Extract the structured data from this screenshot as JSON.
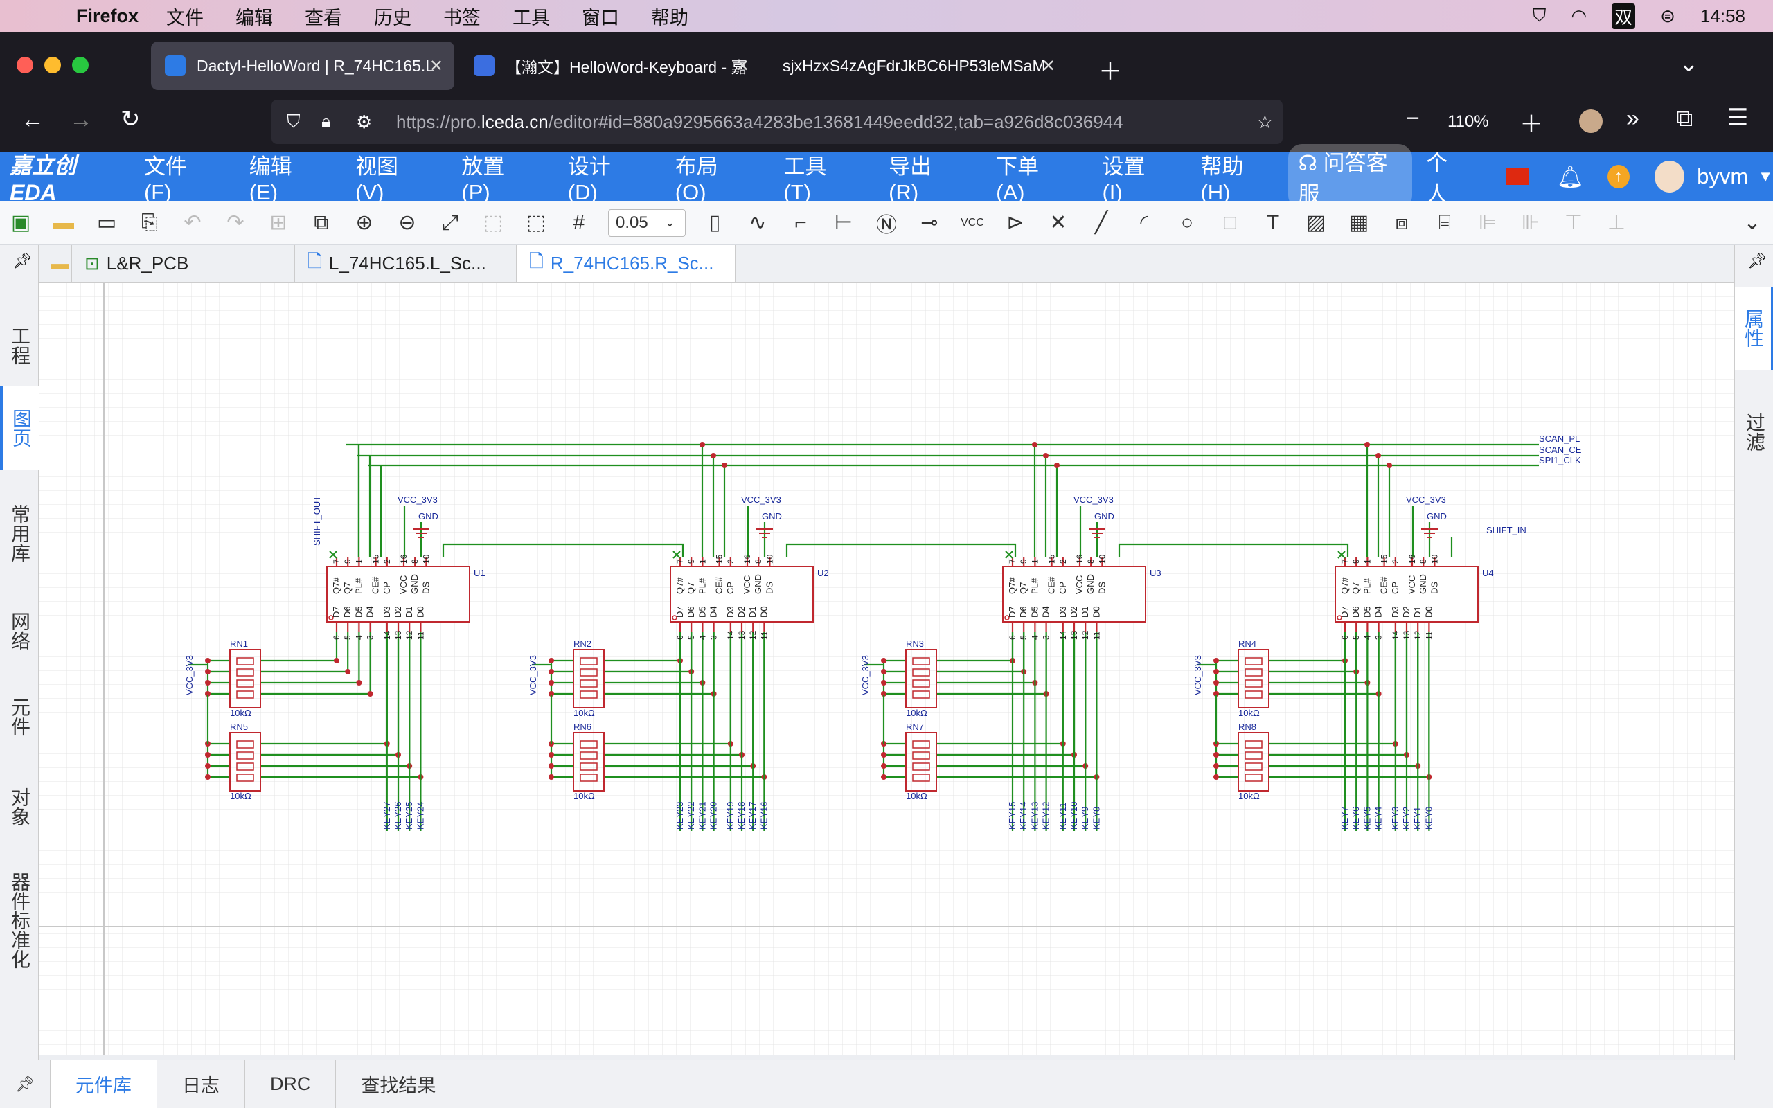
{
  "os_menubar": {
    "app": "Firefox",
    "items": [
      "文件",
      "编辑",
      "查看",
      "历史",
      "书签",
      "工具",
      "窗口",
      "帮助"
    ],
    "ime": "双",
    "clock": "14:58"
  },
  "browser": {
    "tabs": [
      {
        "title": "Dactyl-HelloWord | R_74HC165.L",
        "active": true
      },
      {
        "title": "【瀚文】HelloWord-Keyboard - 嘉",
        "active": false
      },
      {
        "title": "sjxHzxS4zAgFdrJkBC6HP53leMSaM",
        "active": false
      }
    ],
    "url_prefix": "https://pro.",
    "url_domain": "lceda.cn",
    "url_rest": "/editor#id=880a9295663a4283be13681449eedd32,tab=a926d8c036944",
    "zoom": "110%"
  },
  "eda": {
    "logo": "嘉立创EDA",
    "menu": [
      "文件 (F)",
      "编辑 (E)",
      "视图 (V)",
      "放置 (P)",
      "设计 (D)",
      "布局 (O)",
      "工具 (T)",
      "导出 (R)",
      "下单 (A)",
      "设置 (I)",
      "帮助 (H)"
    ],
    "right_label": "问答客服",
    "personal": "个人",
    "username": "byvm",
    "grid_value": "0.05",
    "left_tabs": [
      "工程",
      "图页",
      "常用库",
      "网络",
      "元件",
      "对象",
      "器件标准化"
    ],
    "right_tabs": [
      "属性",
      "过滤"
    ],
    "doc_tabs": [
      "L&R_PCB",
      "L_74HC165.L_Sc...",
      "R_74HC165.R_Sc..."
    ],
    "bottom_tabs": [
      "元件库",
      "日志",
      "DRC",
      "查找结果"
    ],
    "nets_right": [
      "SCAN_PL",
      "SCAN_CE",
      "SPI1_CLK"
    ],
    "shift_out": "SHIFT_OUT",
    "shift_in": "SHIFT_IN",
    "vcc": "VCC_3V3",
    "gnd": "GND",
    "chips": [
      "U1",
      "U2",
      "U3",
      "U4"
    ],
    "resistor_value": "10kΩ",
    "rn_top": [
      "RN1",
      "RN2",
      "RN3",
      "RN4"
    ],
    "rn_bot": [
      "RN5",
      "RN6",
      "RN7",
      "RN8"
    ],
    "pins_top": [
      "Q7#",
      "Q7",
      "PL#",
      "CE#",
      "CP",
      "VCC",
      "GND",
      "DS"
    ],
    "pinnums_top": [
      "7",
      "9",
      "1",
      "15",
      "2",
      "16",
      "8",
      "10"
    ],
    "pins_bot": [
      "D7",
      "D6",
      "D5",
      "D4",
      "D3",
      "D2",
      "D1",
      "D0"
    ],
    "pinnums_bot": [
      "6",
      "5",
      "4",
      "3",
      "14",
      "13",
      "12",
      "11"
    ],
    "keys": [
      [
        "KEY27",
        "KEY26",
        "KEY25",
        "KEY24"
      ],
      [
        "KEY23",
        "KEY22",
        "KEY21",
        "KEY20",
        "KEY19",
        "KEY18",
        "KEY17",
        "KEY16"
      ],
      [
        "KEY15",
        "KEY14",
        "KEY13",
        "KEY12",
        "KEY11",
        "KEY10",
        "KEY9",
        "KEY8"
      ],
      [
        "KEY7",
        "KEY6",
        "KEY5",
        "KEY4",
        "KEY3",
        "KEY2",
        "KEY1",
        "KEY0"
      ]
    ]
  }
}
